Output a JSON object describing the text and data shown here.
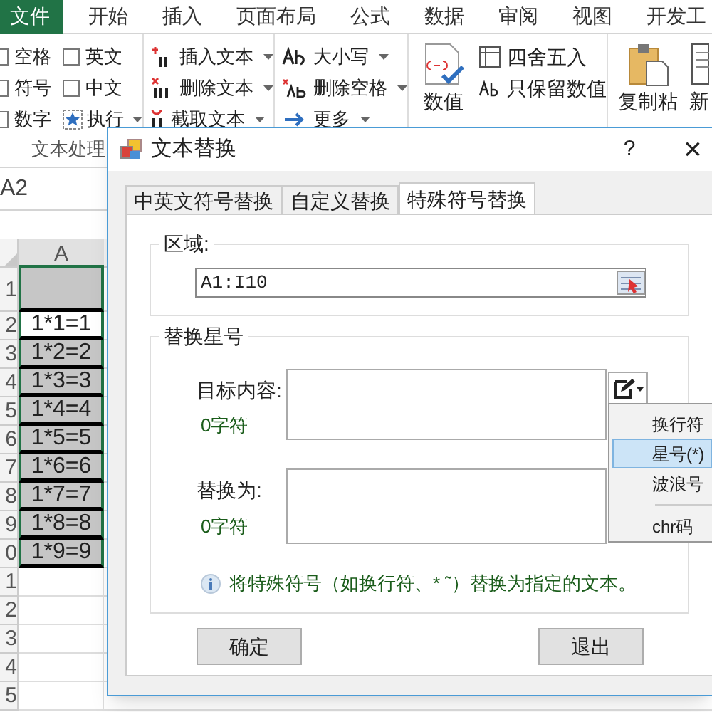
{
  "ribbon": {
    "tabs": [
      {
        "label": "文件",
        "kind": "file"
      },
      {
        "label": "开始",
        "kind": "tab"
      },
      {
        "label": "插入",
        "kind": "tab"
      },
      {
        "label": "页面布局",
        "kind": "tab"
      },
      {
        "label": "公式",
        "kind": "tab"
      },
      {
        "label": "数据",
        "kind": "tab"
      },
      {
        "label": "审阅",
        "kind": "tab"
      },
      {
        "label": "视图",
        "kind": "tab"
      },
      {
        "label": "开发工",
        "kind": "tab"
      }
    ],
    "checkboxes": [
      {
        "label": "空格",
        "checked": false
      },
      {
        "label": "符号",
        "checked": false
      },
      {
        "label": "数字",
        "checked": false
      },
      {
        "label": "英文",
        "checked": false
      },
      {
        "label": "中文",
        "checked": false
      }
    ],
    "run_button": "执行",
    "group_label": "文本处理",
    "text_commands": [
      "插入文本",
      "删除文本",
      "截取文本"
    ],
    "case_commands": [
      "大小写",
      "删除空格",
      "更多"
    ],
    "value_button": "数值",
    "number_commands": [
      "四舍五入",
      "只保留数值"
    ],
    "paste_button": "复制粘",
    "new_button": "新"
  },
  "name_box": "A2",
  "sheet": {
    "column": "A",
    "rows": [
      {
        "number": "1",
        "value": "",
        "kind": "header"
      },
      {
        "number": "2",
        "value": "1*1=1",
        "kind": "white"
      },
      {
        "number": "3",
        "value": "1*2=2",
        "kind": "gray"
      },
      {
        "number": "4",
        "value": "1*3=3",
        "kind": "gray"
      },
      {
        "number": "5",
        "value": "1*4=4",
        "kind": "gray"
      },
      {
        "number": "6",
        "value": "1*5=5",
        "kind": "gray"
      },
      {
        "number": "7",
        "value": "1*6=6",
        "kind": "gray"
      },
      {
        "number": "8",
        "value": "1*7=7",
        "kind": "gray"
      },
      {
        "number": "9",
        "value": "1*8=8",
        "kind": "gray"
      },
      {
        "number": "0",
        "value": "1*9=9",
        "kind": "gray"
      },
      {
        "number": "1",
        "value": "",
        "kind": "empty"
      },
      {
        "number": "2",
        "value": "",
        "kind": "empty"
      },
      {
        "number": "3",
        "value": "",
        "kind": "empty"
      },
      {
        "number": "4",
        "value": "",
        "kind": "empty"
      },
      {
        "number": "5",
        "value": "",
        "kind": "empty"
      }
    ]
  },
  "dialog": {
    "title": "文本替换",
    "help": "?",
    "close": "×",
    "tabs": [
      {
        "label": "中英文符号替换",
        "selected": false
      },
      {
        "label": "自定义替换",
        "selected": false
      },
      {
        "label": "特殊符号替换",
        "selected": true
      }
    ],
    "range_group": {
      "title": "区域:",
      "value": "A1:I10"
    },
    "replace_group": {
      "title": "替换星号",
      "target_label": "目标内容:",
      "target_count": "0字符",
      "replace_label": "替换为:",
      "replace_count": "0字符",
      "menu": [
        {
          "label": "换行符",
          "selected": false
        },
        {
          "label": "星号(*)",
          "selected": true
        },
        {
          "label": "波浪号",
          "selected": false
        },
        {
          "label": "chr码",
          "selected": false,
          "separator_before": true
        }
      ],
      "info": "将特殊符号（如换行符、* ˜）替换为指定的文本。"
    },
    "buttons": [
      "确定",
      "退出"
    ]
  }
}
